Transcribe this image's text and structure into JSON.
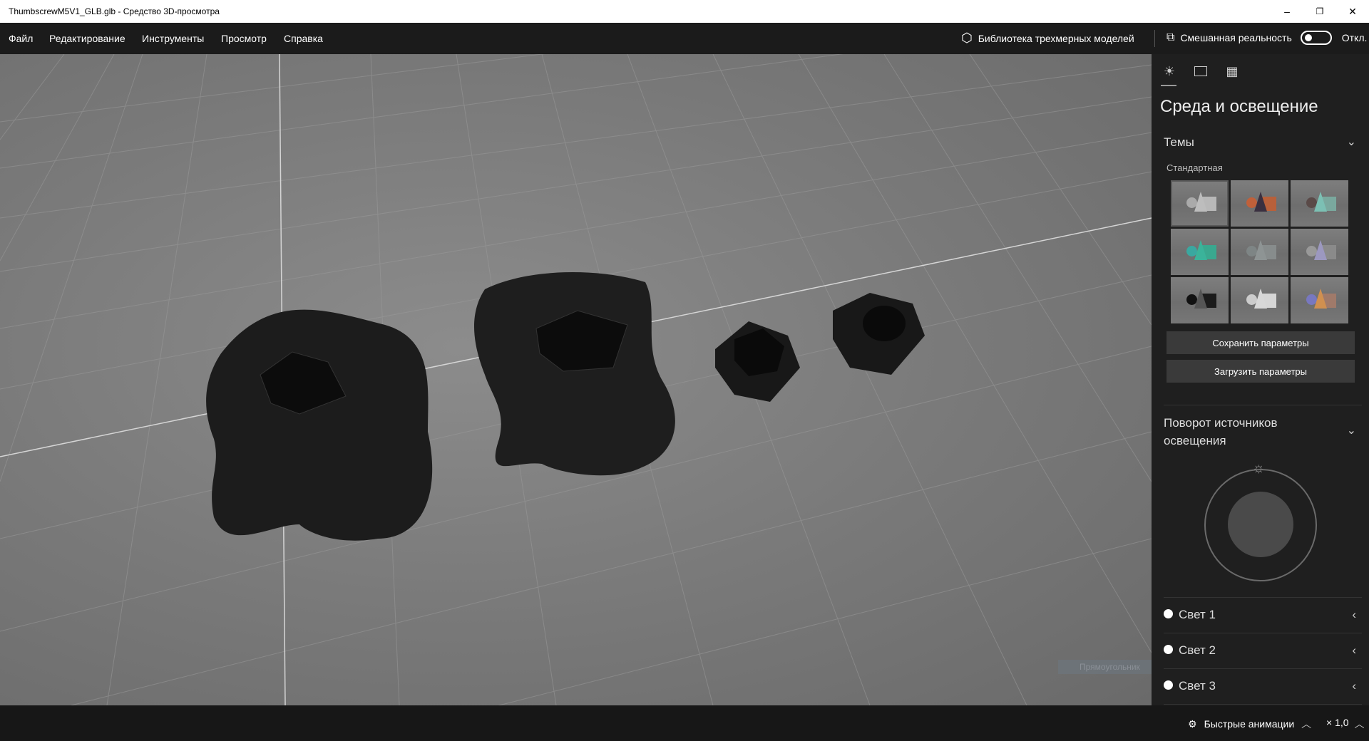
{
  "window": {
    "title": "ThumbscrewM5V1_GLB.glb - Средство 3D-просмотра",
    "minimize": "–",
    "restore": "❐",
    "close": "✕"
  },
  "menu": {
    "items": [
      "Файл",
      "Редактирование",
      "Инструменты",
      "Просмотр",
      "Справка"
    ],
    "library": "Библиотека трехмерных моделей",
    "mixed_reality": "Смешанная реальность",
    "toggle_state": "Откл.",
    "toggle_on": false
  },
  "panel": {
    "tabs": [
      "environment-lighting",
      "stats",
      "grid"
    ],
    "title": "Среда и освещение",
    "themes": {
      "label": "Темы",
      "subtitle": "Стандартная",
      "items": [
        {
          "cone": "#bdbdbd",
          "box": "#b8b8b8",
          "ball": "#aaaaaa"
        },
        {
          "cone": "#3a3040",
          "box": "#b8603a",
          "ball": "#c0603a"
        },
        {
          "cone": "#7cc0b4",
          "box": "#7aa89e",
          "ball": "#5a4a48"
        },
        {
          "cone": "#3bb39a",
          "box": "#3aa88f",
          "ball": "#3aa8a0"
        },
        {
          "cone": "#8e9494",
          "box": "#878c8c",
          "ball": "#7e8585"
        },
        {
          "cone": "#9c98c0",
          "box": "#8a8a8a",
          "ball": "#999999"
        },
        {
          "cone": "#555555",
          "box": "#1b1b1b",
          "ball": "#111111"
        },
        {
          "cone": "#d8d8d8",
          "box": "#d6d6d6",
          "ball": "#cccccc"
        },
        {
          "cone": "#d09050",
          "box": "#a07a6a",
          "ball": "#7878c0"
        }
      ]
    },
    "save_button": "Сохранить параметры",
    "load_button": "Загрузить параметры",
    "rotation": {
      "label": "Поворот источников освещения"
    },
    "lights": [
      "Свет 1",
      "Свет 2",
      "Свет 3"
    ]
  },
  "viewport": {
    "tooltip": "Прямоугольник"
  },
  "bottom": {
    "animations": "Быстрые анимации",
    "speed": "× 1,0"
  }
}
